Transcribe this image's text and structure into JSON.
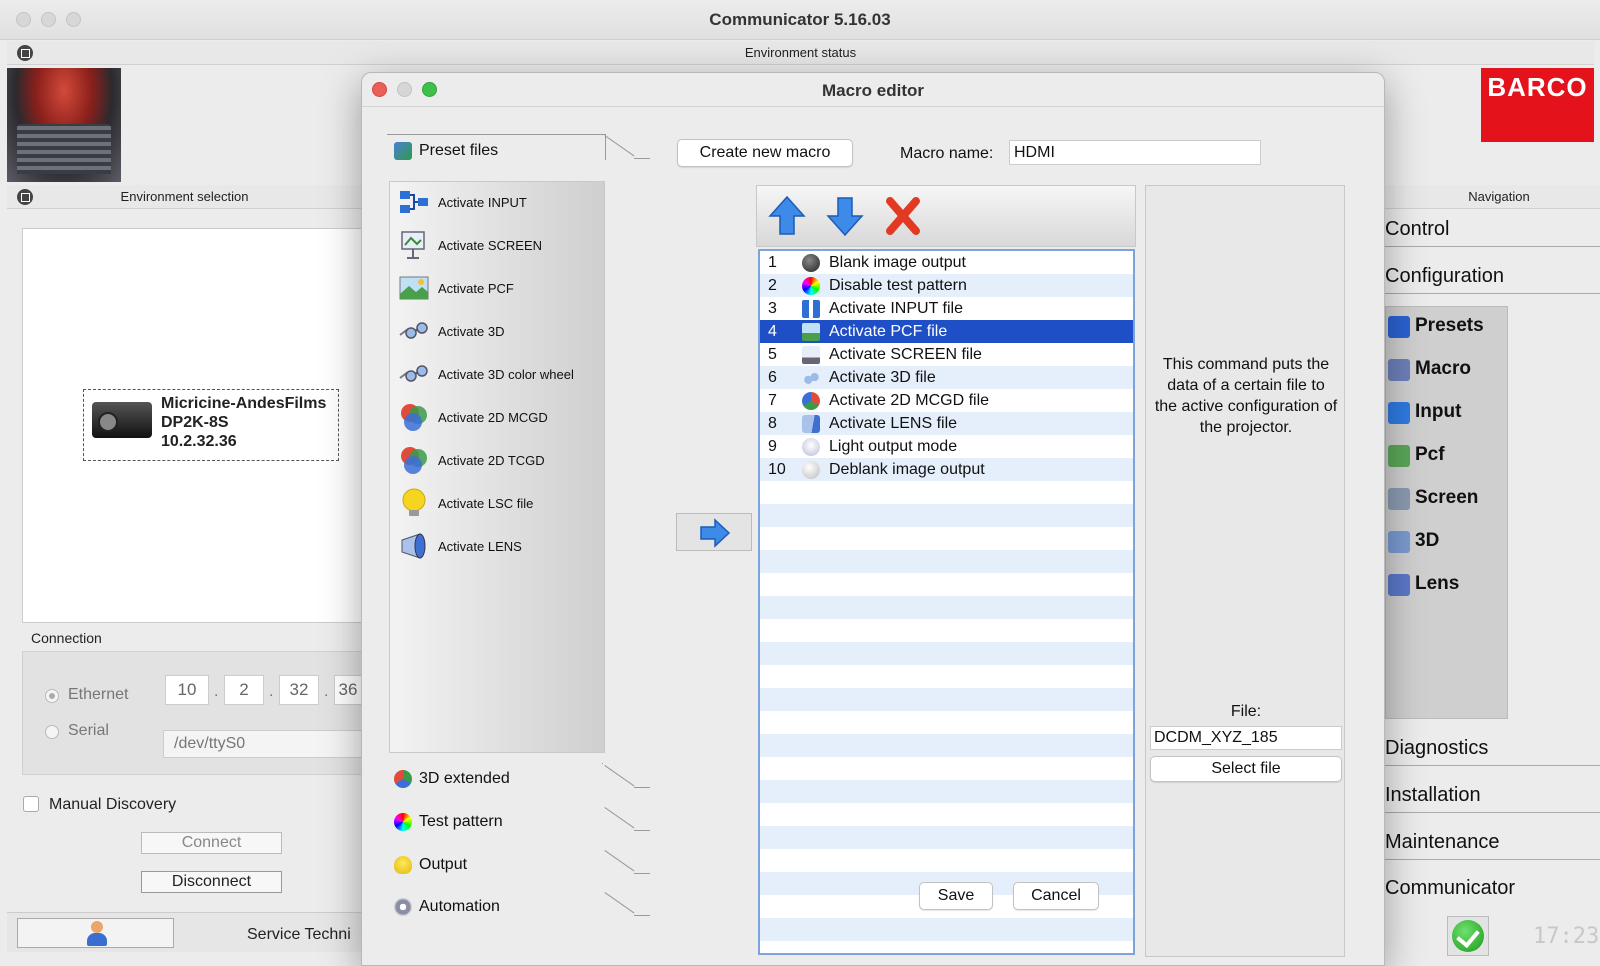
{
  "app": {
    "title": "Communicator 5.16.03"
  },
  "panels": {
    "environment_status": "Environment status",
    "environment_selection": "Environment selection",
    "navigation": "Navigation"
  },
  "brand": {
    "logo_text": "BARCO",
    "color": "#e3121b"
  },
  "device": {
    "name": "Micricine-AndesFilms",
    "model": "DP2K-8S",
    "ip": "10.2.32.36"
  },
  "connection": {
    "label": "Connection",
    "ethernet_label": "Ethernet",
    "serial_label": "Serial",
    "ip_parts": [
      "10",
      "2",
      "32",
      "36"
    ],
    "serial_port": "/dev/ttyS0",
    "manual_discovery_label": "Manual Discovery",
    "connect_label": "Connect",
    "disconnect_label": "Disconnect"
  },
  "user": {
    "role": "Service Techni"
  },
  "navigation": {
    "tabs": [
      "Control",
      "Configuration",
      "Diagnostics",
      "Installation",
      "Maintenance",
      "Communicator"
    ],
    "sub_items": [
      "Presets",
      "Macro",
      "Input",
      "Pcf",
      "Screen",
      "3D",
      "Lens"
    ]
  },
  "clock": "17:23",
  "dialog": {
    "title": "Macro editor",
    "tabs": {
      "preset_files": "Preset files",
      "extended_3d": "3D extended",
      "test_pattern": "Test pattern",
      "output": "Output",
      "automation": "Automation"
    },
    "preset_items": [
      "Activate INPUT",
      "Activate SCREEN",
      "Activate PCF",
      "Activate 3D",
      "Activate 3D color wheel",
      "Activate 2D MCGD",
      "Activate 2D TCGD",
      "Activate LSC file",
      "Activate LENS"
    ],
    "create_new_label": "Create new macro",
    "macro_name_label": "Macro name:",
    "macro_name_value": "HDMI",
    "commands": [
      {
        "num": "1",
        "label": "Blank image output"
      },
      {
        "num": "2",
        "label": "Disable test pattern"
      },
      {
        "num": "3",
        "label": "Activate INPUT file"
      },
      {
        "num": "4",
        "label": "Activate PCF file"
      },
      {
        "num": "5",
        "label": "Activate SCREEN file"
      },
      {
        "num": "6",
        "label": "Activate 3D file"
      },
      {
        "num": "7",
        "label": "Activate 2D MCGD file"
      },
      {
        "num": "8",
        "label": "Activate LENS file"
      },
      {
        "num": "9",
        "label": "Light output mode"
      },
      {
        "num": "10",
        "label": "Deblank image output"
      }
    ],
    "selected_command": "4",
    "description": "This command puts the data of a certain file to the active configuration of the projector.",
    "file_label": "File:",
    "file_value": "DCDM_XYZ_185",
    "select_file_label": "Select file",
    "save_label": "Save",
    "cancel_label": "Cancel"
  }
}
